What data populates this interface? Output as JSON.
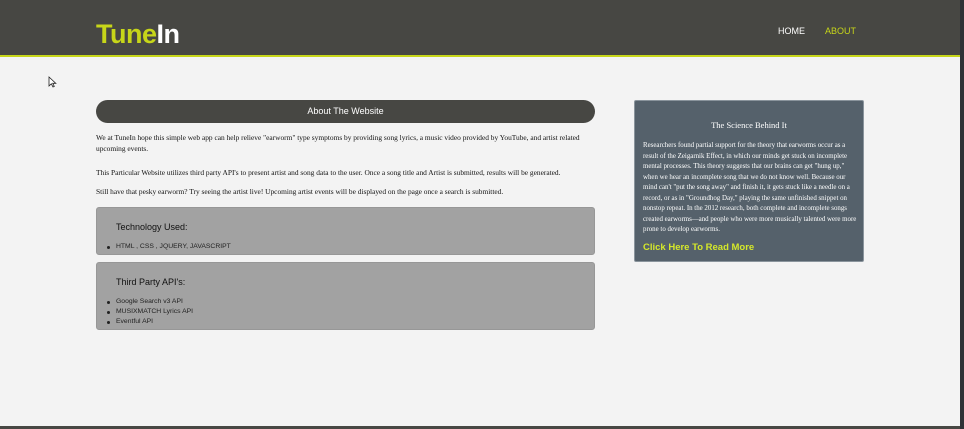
{
  "nav": {
    "logo_part1": "Tune",
    "logo_part2": "In",
    "home_label": "HOME",
    "about_label": "ABOUT"
  },
  "about": {
    "heading": "About The Website",
    "paragraphs": [
      "We at TuneIn hope this simple web app can help relieve \"earworm\" type symptoms by providing song lyrics, a music video provided by YouTube, and artist related upcoming events.",
      "This Particular Website utilizes third party API's to present artist and song data to the user. Once a song title and Artist is submitted, results will be generated.",
      "Still have that pesky earworm? Try seeing the artist live! Upcoming artist events will be displayed on the page once a search is submitted."
    ]
  },
  "technology": {
    "title": "Technology Used:",
    "items": [
      "HTML , CSS , JQUERY, JAVASCRIPT"
    ]
  },
  "apis": {
    "title": "Third Party API's:",
    "items": [
      "Google Search v3 API",
      "MUSIXMATCH Lyrics API",
      "Eventful API"
    ]
  },
  "science": {
    "title": "The Science Behind It",
    "body": "Researchers found partial support for the theory that earworms occur as a result of the Zeigarnik Effect, in which our minds get stuck on incomplete mental processes. This theory suggests that our brains can get \"hung up,\" when we hear an incomplete song that we do not know well. Because our mind can't \"put the song away\" and finish it, it gets stuck like a needle on a record, or as in \"Groundhog Day,\" playing the same unfinished snippet on nonstop repeat. In the 2012 research, both complete and incomplete songs created earworms—and people who were more musically talented were more prone to develop earworms.",
    "link_label": "Click Here To Read More"
  },
  "colors": {
    "accent": "#c7d619",
    "nav_bg": "#474743",
    "panel_bg": "#55616b",
    "box_bg": "#a2a2a2"
  },
  "icons": {
    "cursor": "mouse-pointer-icon"
  }
}
